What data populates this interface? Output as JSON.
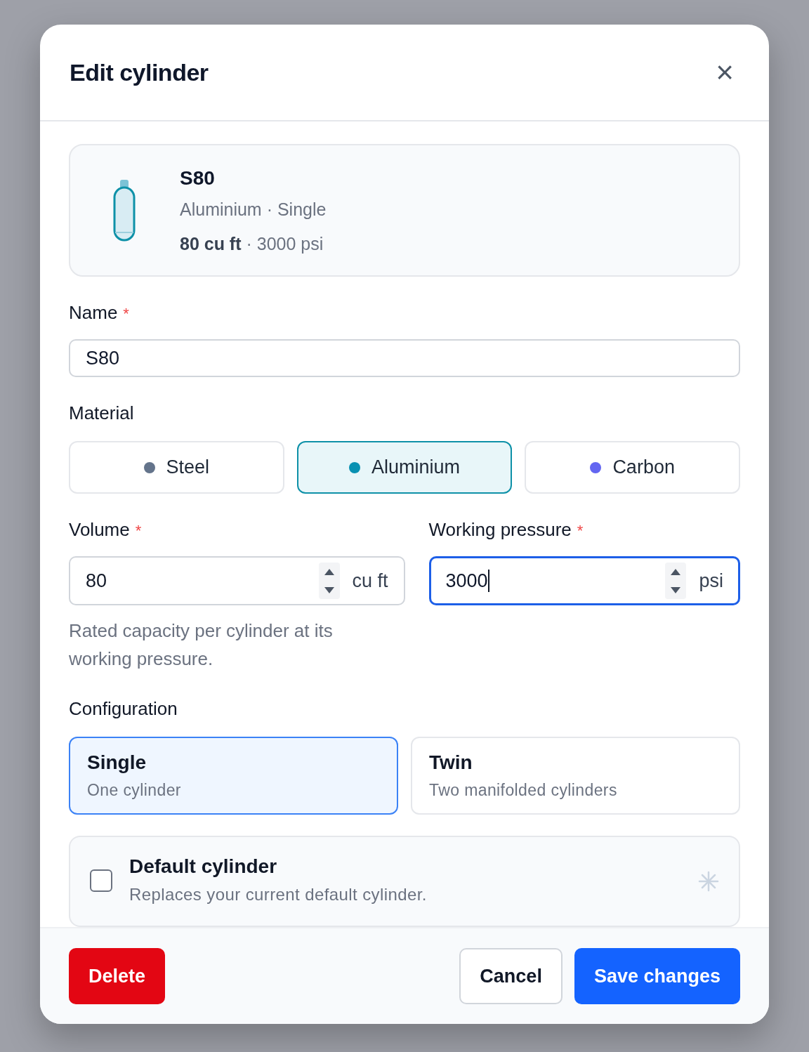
{
  "dialog": {
    "title": "Edit cylinder",
    "close_icon": "×"
  },
  "summary": {
    "name": "S80",
    "subtitle": "Aluminium · Single",
    "specs": "**80 cu ft** · 3000 psi"
  },
  "name_field": {
    "label": "Name",
    "required_mark": "*",
    "value": "S80",
    "focused": false
  },
  "material": {
    "label": "Material",
    "options": [
      {
        "label": "Steel",
        "color": "#64748b",
        "selected": false
      },
      {
        "label": "Aluminium",
        "color": "#0891b2",
        "selected": true
      },
      {
        "label": "Carbon",
        "color": "#6366f1",
        "selected": false
      }
    ]
  },
  "volume_field": {
    "label": "Volume",
    "required_mark": "*",
    "value": "80",
    "unit": "cu ft",
    "focused": false,
    "help": "Rated capacity per cylinder at its working pressure."
  },
  "pressure_field": {
    "label": "Working pressure",
    "required_mark": "*",
    "value": "3000",
    "unit": "psi",
    "focused": true
  },
  "configuration": {
    "label": "Configuration",
    "options": [
      {
        "title": "Single",
        "description": "One cylinder",
        "selected": true
      },
      {
        "title": "Twin",
        "description": "Two manifolded cylinders",
        "selected": false
      }
    ]
  },
  "default_option": {
    "title": "Default cylinder",
    "description": "Replaces your current default cylinder.",
    "checked": false
  },
  "footer": {
    "delete": "Delete",
    "cancel": "Cancel",
    "save": "Save changes"
  }
}
